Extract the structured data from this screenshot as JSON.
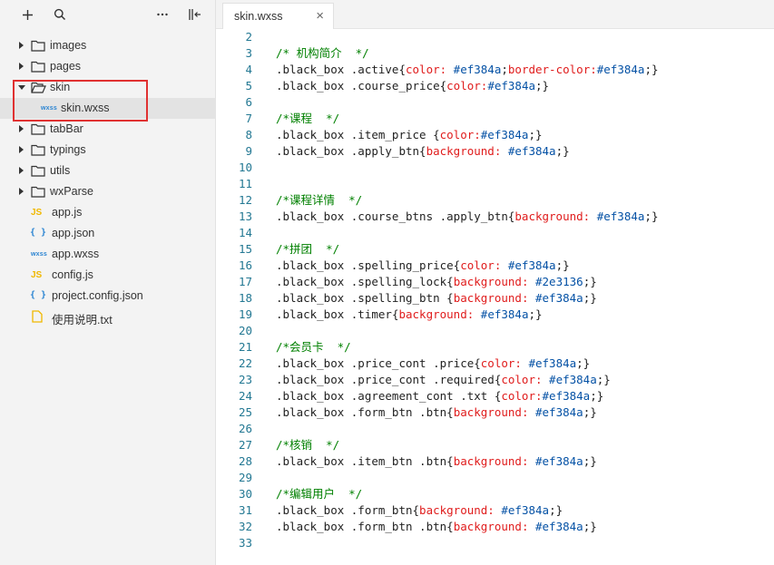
{
  "toolbar": {
    "add_icon": "plus-icon",
    "search_icon": "search-icon",
    "more_icon": "more-icon",
    "collapse_icon": "collapse-sidebar-icon"
  },
  "tree": [
    {
      "label": "images",
      "type": "folder",
      "expanded": false,
      "depth": 0
    },
    {
      "label": "pages",
      "type": "folder",
      "expanded": false,
      "depth": 0
    },
    {
      "label": "skin",
      "type": "folder",
      "expanded": true,
      "depth": 0
    },
    {
      "label": "skin.wxss",
      "type": "wxss",
      "depth": 1,
      "selected": true
    },
    {
      "label": "tabBar",
      "type": "folder",
      "expanded": false,
      "depth": 0
    },
    {
      "label": "typings",
      "type": "folder",
      "expanded": false,
      "depth": 0
    },
    {
      "label": "utils",
      "type": "folder",
      "expanded": false,
      "depth": 0
    },
    {
      "label": "wxParse",
      "type": "folder",
      "expanded": false,
      "depth": 0
    },
    {
      "label": "app.js",
      "type": "js",
      "depth": 0
    },
    {
      "label": "app.json",
      "type": "json",
      "depth": 0
    },
    {
      "label": "app.wxss",
      "type": "wxss",
      "depth": 0
    },
    {
      "label": "config.js",
      "type": "js",
      "depth": 0
    },
    {
      "label": "project.config.json",
      "type": "json",
      "depth": 0
    },
    {
      "label": "使用说明.txt",
      "type": "txt",
      "depth": 0
    }
  ],
  "icon_text": {
    "js": "JS",
    "json": "{ }",
    "wxss": "wxss"
  },
  "tab": {
    "label": "skin.wxss",
    "close": "×"
  },
  "code_lines": [
    {
      "n": "2",
      "tokens": []
    },
    {
      "n": "3",
      "tokens": [
        [
          "comment",
          "/* 机构简介  */"
        ]
      ]
    },
    {
      "n": "4",
      "tokens": [
        [
          "sel",
          ".black_box .active"
        ],
        [
          "punc",
          "{"
        ],
        [
          "prop",
          "color:"
        ],
        [
          "val",
          " #ef384a"
        ],
        [
          "punc",
          ";"
        ],
        [
          "prop",
          "border-color:"
        ],
        [
          "val",
          "#ef384a"
        ],
        [
          "punc",
          ";}"
        ]
      ]
    },
    {
      "n": "5",
      "tokens": [
        [
          "sel",
          ".black_box .course_price"
        ],
        [
          "punc",
          "{"
        ],
        [
          "prop",
          "color:"
        ],
        [
          "val",
          "#ef384a"
        ],
        [
          "punc",
          ";}"
        ]
      ]
    },
    {
      "n": "6",
      "tokens": []
    },
    {
      "n": "7",
      "tokens": [
        [
          "comment",
          "/*课程  */"
        ]
      ]
    },
    {
      "n": "8",
      "tokens": [
        [
          "sel",
          ".black_box .item_price "
        ],
        [
          "punc",
          "{"
        ],
        [
          "prop",
          "color:"
        ],
        [
          "val",
          "#ef384a"
        ],
        [
          "punc",
          ";}"
        ]
      ]
    },
    {
      "n": "9",
      "tokens": [
        [
          "sel",
          ".black_box .apply_btn"
        ],
        [
          "punc",
          "{"
        ],
        [
          "prop",
          "background:"
        ],
        [
          "val",
          " #ef384a"
        ],
        [
          "punc",
          ";}"
        ]
      ]
    },
    {
      "n": "10",
      "tokens": []
    },
    {
      "n": "11",
      "tokens": []
    },
    {
      "n": "12",
      "tokens": [
        [
          "comment",
          "/*课程详情  */"
        ]
      ]
    },
    {
      "n": "13",
      "tokens": [
        [
          "sel",
          ".black_box .course_btns .apply_btn"
        ],
        [
          "punc",
          "{"
        ],
        [
          "prop",
          "background:"
        ],
        [
          "val",
          " #ef384a"
        ],
        [
          "punc",
          ";}"
        ]
      ]
    },
    {
      "n": "14",
      "tokens": []
    },
    {
      "n": "15",
      "tokens": [
        [
          "comment",
          "/*拼团  */"
        ]
      ]
    },
    {
      "n": "16",
      "tokens": [
        [
          "sel",
          ".black_box .spelling_price"
        ],
        [
          "punc",
          "{"
        ],
        [
          "prop",
          "color:"
        ],
        [
          "val",
          " #ef384a"
        ],
        [
          "punc",
          ";}"
        ]
      ]
    },
    {
      "n": "17",
      "tokens": [
        [
          "sel",
          ".black_box .spelling_lock"
        ],
        [
          "punc",
          "{"
        ],
        [
          "prop",
          "background:"
        ],
        [
          "val",
          " #2e3136"
        ],
        [
          "punc",
          ";}"
        ]
      ]
    },
    {
      "n": "18",
      "tokens": [
        [
          "sel",
          ".black_box .spelling_btn "
        ],
        [
          "punc",
          "{"
        ],
        [
          "prop",
          "background:"
        ],
        [
          "val",
          " #ef384a"
        ],
        [
          "punc",
          ";}"
        ]
      ]
    },
    {
      "n": "19",
      "tokens": [
        [
          "sel",
          ".black_box .timer"
        ],
        [
          "punc",
          "{"
        ],
        [
          "prop",
          "background:"
        ],
        [
          "val",
          " #ef384a"
        ],
        [
          "punc",
          ";}"
        ]
      ]
    },
    {
      "n": "20",
      "tokens": []
    },
    {
      "n": "21",
      "tokens": [
        [
          "comment",
          "/*会员卡  */"
        ]
      ]
    },
    {
      "n": "22",
      "tokens": [
        [
          "sel",
          ".black_box .price_cont .price"
        ],
        [
          "punc",
          "{"
        ],
        [
          "prop",
          "color:"
        ],
        [
          "val",
          " #ef384a"
        ],
        [
          "punc",
          ";}"
        ]
      ]
    },
    {
      "n": "23",
      "tokens": [
        [
          "sel",
          ".black_box .price_cont .required"
        ],
        [
          "punc",
          "{"
        ],
        [
          "prop",
          "color:"
        ],
        [
          "val",
          " #ef384a"
        ],
        [
          "punc",
          ";}"
        ]
      ]
    },
    {
      "n": "24",
      "tokens": [
        [
          "sel",
          ".black_box .agreement_cont .txt "
        ],
        [
          "punc",
          "{"
        ],
        [
          "prop",
          "color:"
        ],
        [
          "val",
          "#ef384a"
        ],
        [
          "punc",
          ";}"
        ]
      ]
    },
    {
      "n": "25",
      "tokens": [
        [
          "sel",
          ".black_box .form_btn .btn"
        ],
        [
          "punc",
          "{"
        ],
        [
          "prop",
          "background:"
        ],
        [
          "val",
          " #ef384a"
        ],
        [
          "punc",
          ";}"
        ]
      ]
    },
    {
      "n": "26",
      "tokens": []
    },
    {
      "n": "27",
      "tokens": [
        [
          "comment",
          "/*核销  */"
        ]
      ]
    },
    {
      "n": "28",
      "tokens": [
        [
          "sel",
          ".black_box .item_btn .btn"
        ],
        [
          "punc",
          "{"
        ],
        [
          "prop",
          "background:"
        ],
        [
          "val",
          " #ef384a"
        ],
        [
          "punc",
          ";}"
        ]
      ]
    },
    {
      "n": "29",
      "tokens": []
    },
    {
      "n": "30",
      "tokens": [
        [
          "comment",
          "/*编辑用户  */"
        ]
      ]
    },
    {
      "n": "31",
      "tokens": [
        [
          "sel",
          ".black_box .form_btn"
        ],
        [
          "punc",
          "{"
        ],
        [
          "prop",
          "background:"
        ],
        [
          "val",
          " #ef384a"
        ],
        [
          "punc",
          ";}"
        ]
      ]
    },
    {
      "n": "32",
      "tokens": [
        [
          "sel",
          ".black_box .form_btn .btn"
        ],
        [
          "punc",
          "{"
        ],
        [
          "prop",
          "background:"
        ],
        [
          "val",
          " #ef384a"
        ],
        [
          "punc",
          ";}"
        ]
      ]
    },
    {
      "n": "33",
      "tokens": []
    }
  ],
  "colors": {
    "highlight_box": "#e03131",
    "comment": "#008000",
    "property": "#e01c1c",
    "value": "#0451a5",
    "line_number": "#237893"
  }
}
